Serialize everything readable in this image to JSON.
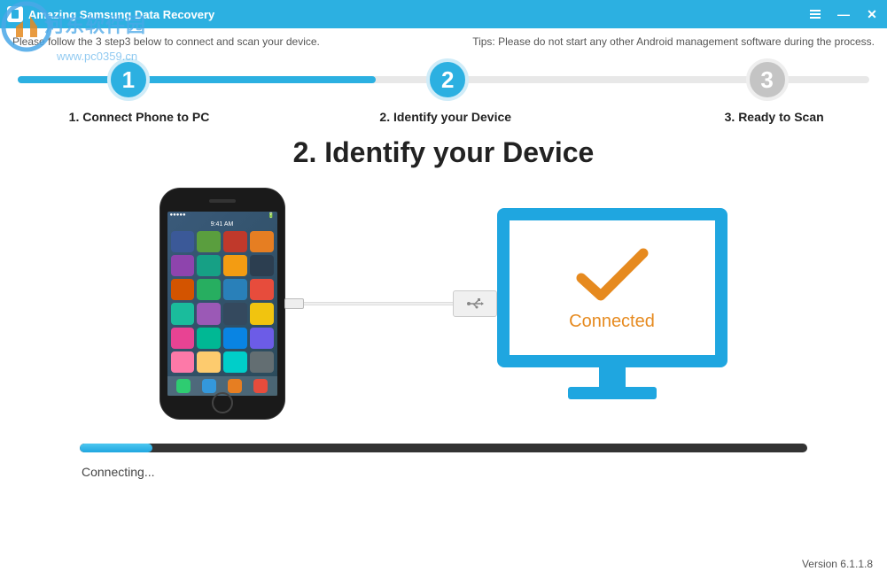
{
  "titlebar": {
    "title": "Amazing Samsung Data Recovery"
  },
  "info": {
    "left": "Please follow the 3 step3 below to connect and scan your device.",
    "right": "Tips: Please do not start any other Android management software during the process."
  },
  "steps": {
    "s1": {
      "num": "1",
      "label": "1. Connect Phone to PC"
    },
    "s2": {
      "num": "2",
      "label": "2. Identify your Device"
    },
    "s3": {
      "num": "3",
      "label": "3. Ready to Scan"
    }
  },
  "heading": "2. Identify your Device",
  "monitor": {
    "connected": "Connected"
  },
  "phone": {
    "carrier": "●●●●●",
    "time": "9:41 AM"
  },
  "cable": {
    "usb_symbol": "⊶"
  },
  "progress": {
    "label": "Connecting...",
    "percent": 10
  },
  "version": "Version 6.1.1.8",
  "watermark": {
    "text": "河东软件园",
    "url": "www.pc0359.cn"
  },
  "colors": {
    "primary": "#2cb0e1",
    "accent": "#e68a1f"
  },
  "app_colors": [
    "#3b5998",
    "#5a9e3e",
    "#c0392b",
    "#e67e22",
    "#8e44ad",
    "#16a085",
    "#f39c12",
    "#2c3e50",
    "#d35400",
    "#27ae60",
    "#2980b9",
    "#e74c3c",
    "#1abc9c",
    "#9b59b6",
    "#34495e",
    "#f1c40f",
    "#e84393",
    "#00b894",
    "#0984e3",
    "#6c5ce7",
    "#fd79a8",
    "#fdcb6e",
    "#00cec9",
    "#636e72"
  ],
  "dock_colors": [
    "#2ecc71",
    "#3498db",
    "#e67e22",
    "#e74c3c"
  ]
}
